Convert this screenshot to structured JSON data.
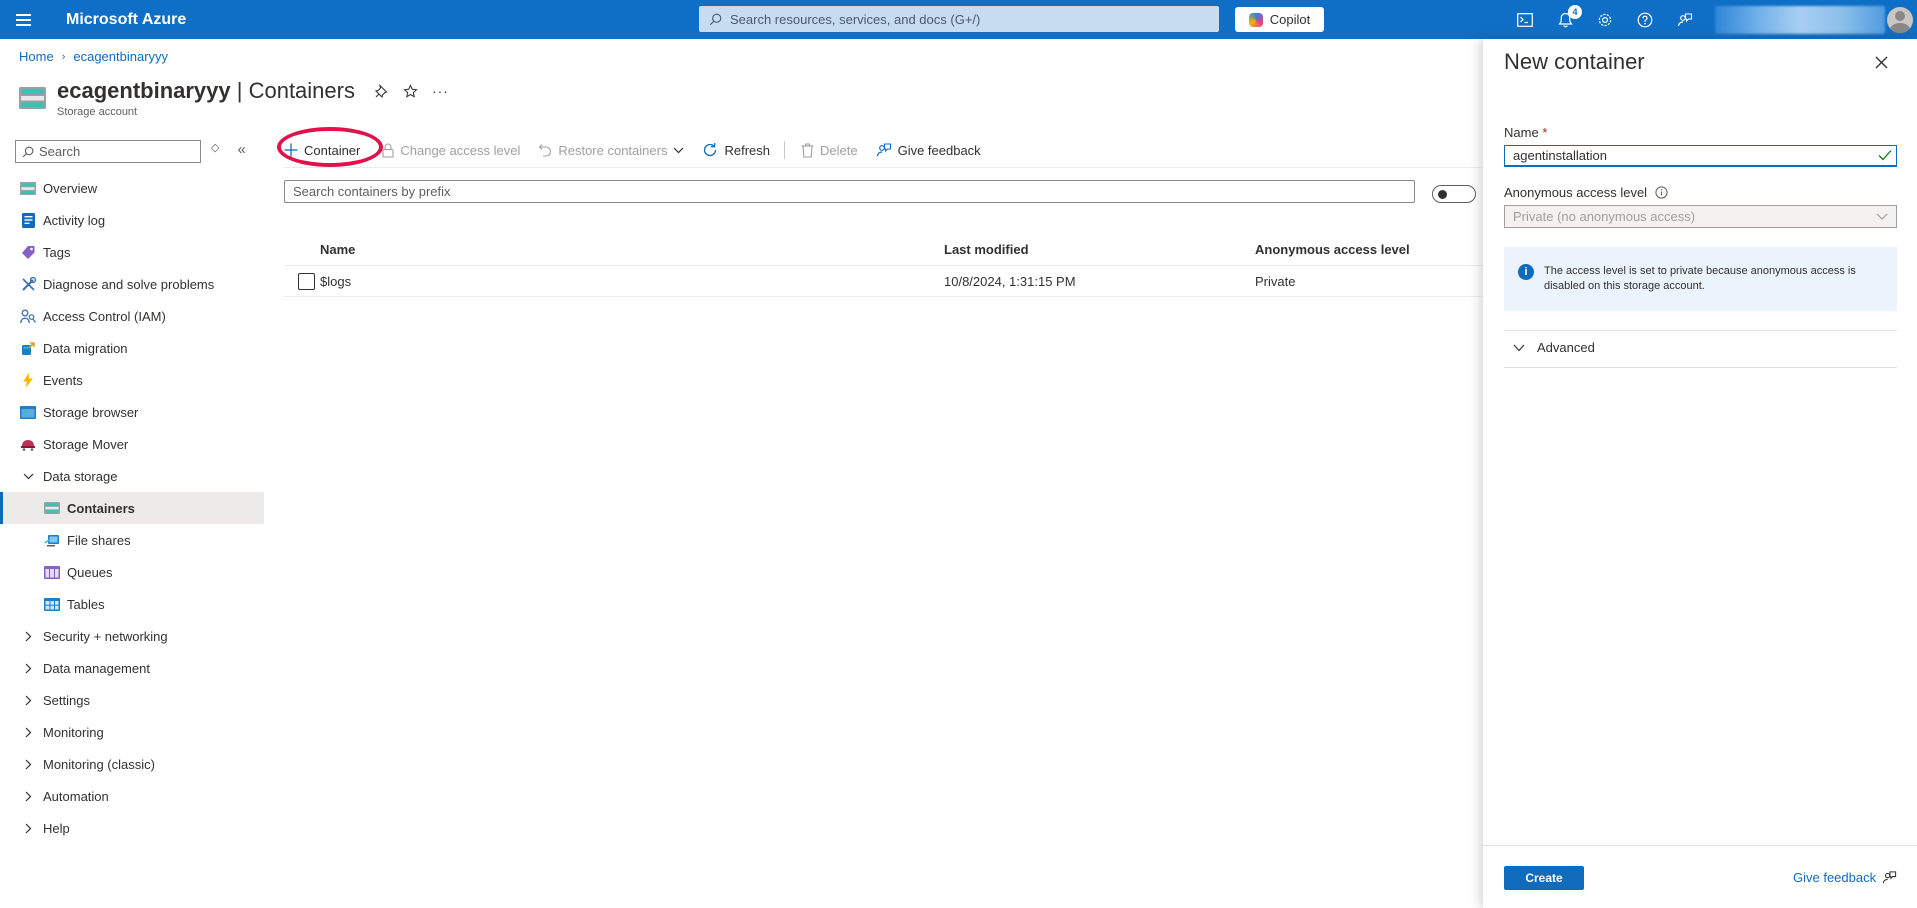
{
  "topbar": {
    "brand": "Microsoft Azure",
    "search_placeholder": "Search resources, services, and docs (G+/)",
    "copilot_label": "Copilot",
    "notification_count": "4"
  },
  "breadcrumb": {
    "home": "Home",
    "resource": "ecagentbinaryyy"
  },
  "header": {
    "resource_name": "ecagentbinaryyy",
    "page_name": " | Containers",
    "subtitle": "Storage account"
  },
  "nav": {
    "search_placeholder": "Search",
    "items": [
      {
        "label": "Overview"
      },
      {
        "label": "Activity log"
      },
      {
        "label": "Tags"
      },
      {
        "label": "Diagnose and solve problems"
      },
      {
        "label": "Access Control (IAM)"
      },
      {
        "label": "Data migration"
      },
      {
        "label": "Events"
      },
      {
        "label": "Storage browser"
      },
      {
        "label": "Storage Mover"
      }
    ],
    "data_storage_group": "Data storage",
    "data_storage_items": [
      {
        "label": "Containers"
      },
      {
        "label": "File shares"
      },
      {
        "label": "Queues"
      },
      {
        "label": "Tables"
      }
    ],
    "groups": [
      {
        "label": "Security + networking"
      },
      {
        "label": "Data management"
      },
      {
        "label": "Settings"
      },
      {
        "label": "Monitoring"
      },
      {
        "label": "Monitoring (classic)"
      },
      {
        "label": "Automation"
      },
      {
        "label": "Help"
      }
    ]
  },
  "toolbar": {
    "container": "Container",
    "change_access": "Change access level",
    "restore": "Restore containers",
    "refresh": "Refresh",
    "delete": "Delete",
    "feedback": "Give feedback"
  },
  "containers": {
    "search_placeholder": "Search containers by prefix",
    "columns": {
      "name": "Name",
      "modified": "Last modified",
      "access": "Anonymous access level"
    },
    "rows": [
      {
        "name": "$logs",
        "modified": "10/8/2024, 1:31:15 PM",
        "access": "Private"
      }
    ]
  },
  "panel": {
    "title": "New container",
    "name_label": "Name",
    "required_mark": "*",
    "name_value": "agentinstallation",
    "access_label": "Anonymous access level",
    "access_value": "Private (no anonymous access)",
    "info_text": "The access level is set to private because anonymous access is disabled on this storage account.",
    "advanced_label": "Advanced",
    "create_label": "Create",
    "feedback_label": "Give feedback"
  },
  "colors": {
    "topbar": "#0f6fc6",
    "accent": "#0f6cbd",
    "highlight": "#e0114b"
  }
}
